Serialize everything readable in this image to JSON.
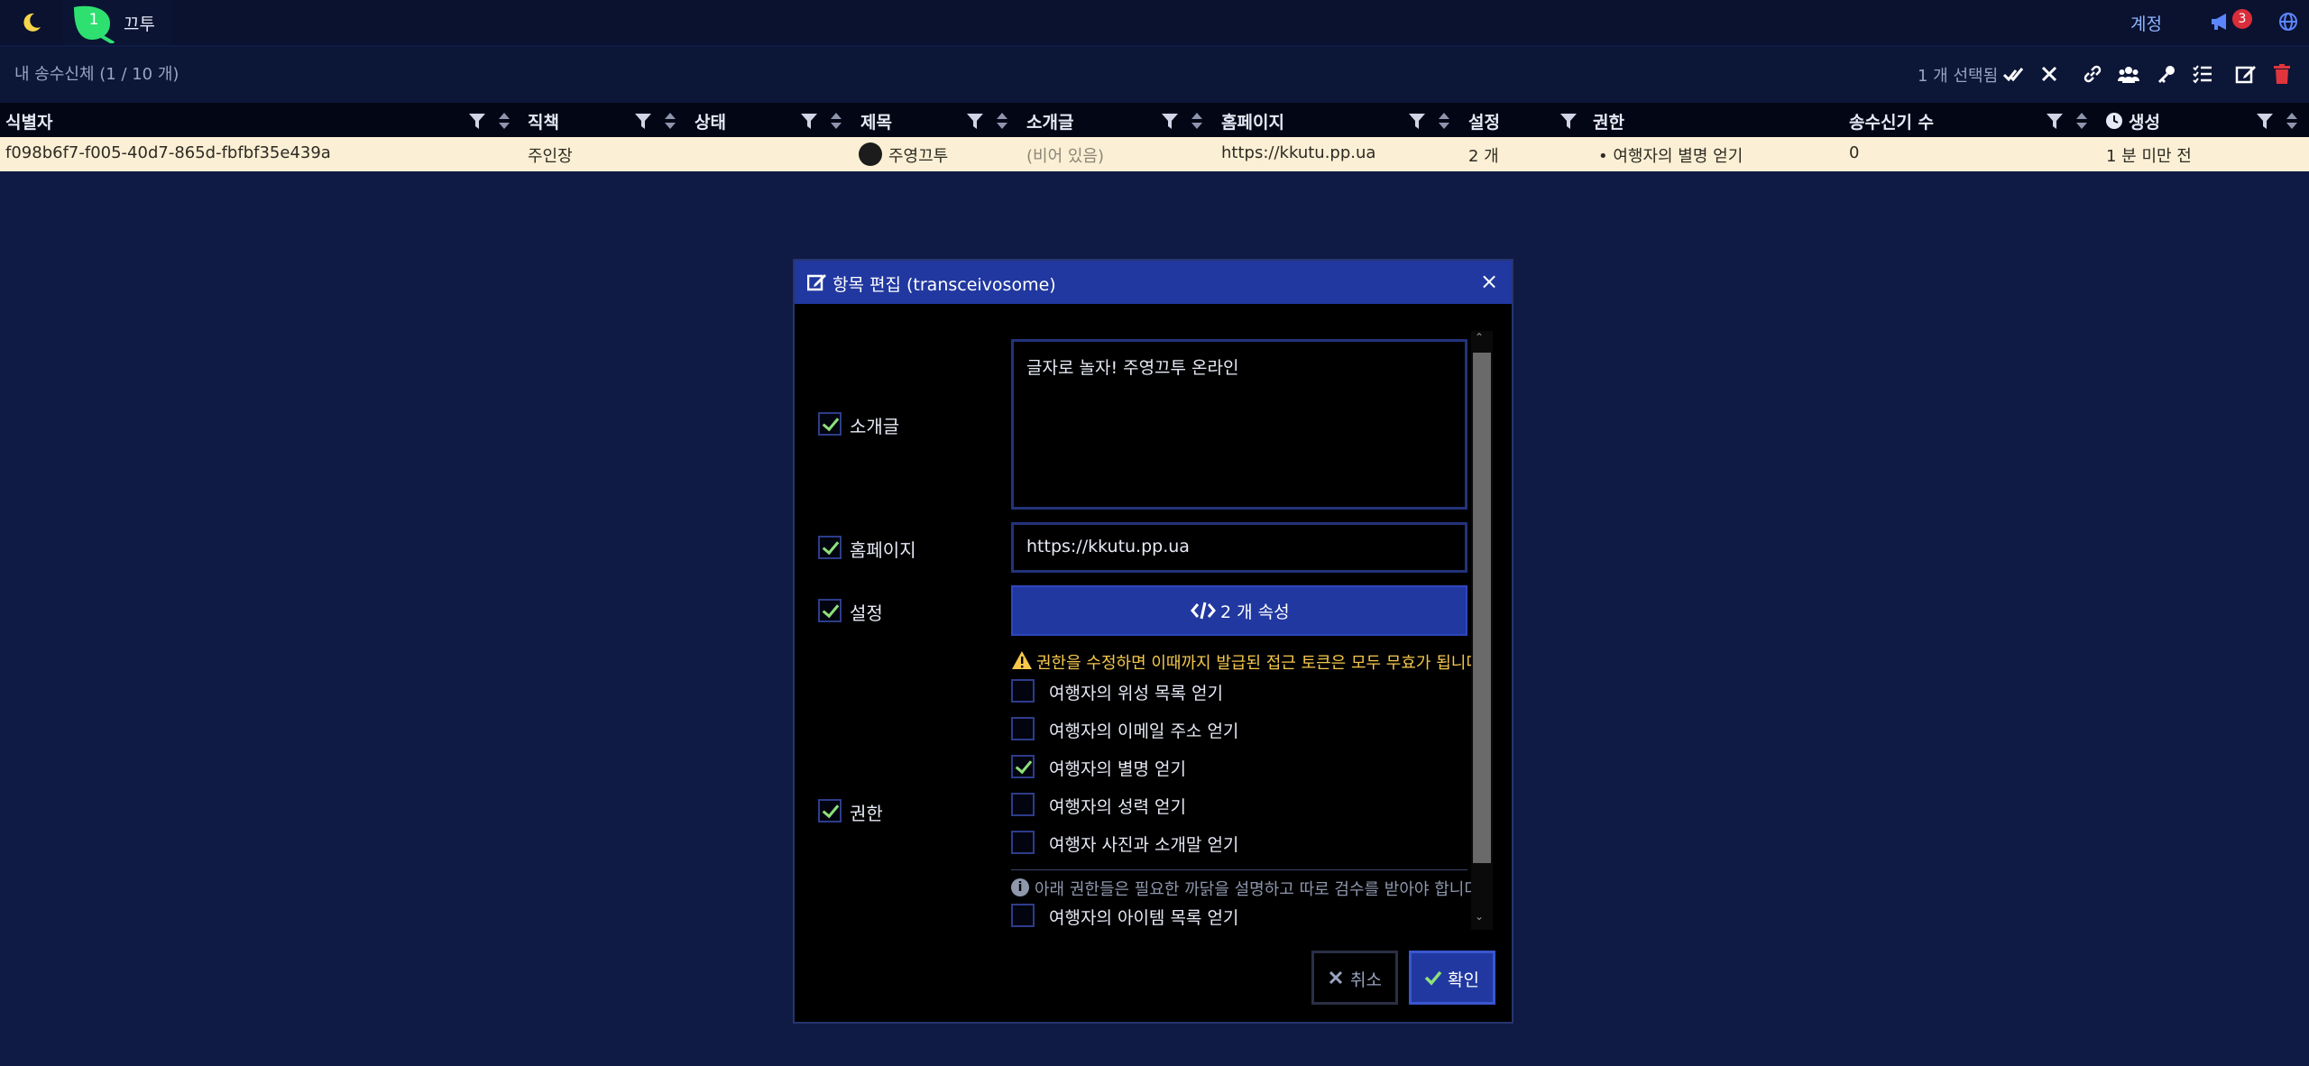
{
  "topbar": {
    "tab_count": "1",
    "app_name": "끄투",
    "account_label": "계정",
    "notification_count": "3"
  },
  "toolbar": {
    "title": "내 송수신체 (1 / 10 개)",
    "selection": "1 개 선택됨"
  },
  "table": {
    "headers": {
      "id": "식별자",
      "role": "직책",
      "status": "상태",
      "title": "제목",
      "intro": "소개글",
      "homepage": "홈페이지",
      "settings": "설정",
      "permissions": "권한",
      "receivers": "송수신기 수",
      "created": "생성"
    },
    "row": {
      "id": "f098b6f7-f005-40d7-865d-fbfbf35e439a",
      "role": "주인장",
      "status": "",
      "title": "주영끄투",
      "intro": "(비어 있음)",
      "homepage": "https://kkutu.pp.ua",
      "settings": "2 개",
      "permissions": "• 여행자의 별명 얻기",
      "receivers": "0",
      "created": "1 분 미만 전"
    }
  },
  "modal": {
    "title": "항목 편집 (transceivosome)",
    "close": "×",
    "fields": {
      "intro_label": "소개글",
      "intro_value": "글자로 놀자! 주영끄투 온라인",
      "homepage_label": "홈페이지",
      "homepage_value": "https://kkutu.pp.ua",
      "settings_label": "설정",
      "settings_button": "2 개 속성",
      "permissions_label": "권한"
    },
    "warning": "권한을 수정하면 이때까지 발급된 접근 토큰은 모두 무효가 됩니다.",
    "permissions": [
      {
        "label": "여행자의 위성 목록 얻기",
        "checked": false
      },
      {
        "label": "여행자의 이메일 주소 얻기",
        "checked": false
      },
      {
        "label": "여행자의 별명 얻기",
        "checked": true
      },
      {
        "label": "여행자의 성력 얻기",
        "checked": false
      },
      {
        "label": "여행자 사진과 소개말 얻기",
        "checked": false
      }
    ],
    "info": "아래 권한들은 필요한 까닭을 설명하고 따로 검수를 받아야 합니다.",
    "extra_permission": "여행자의 아이템 목록 얻기",
    "cancel": "취소",
    "confirm": "확인"
  },
  "colors": {
    "background": "#0f1b45",
    "accent": "#2138a0",
    "row_highlight": "#fbf0d5",
    "warning": "#f5c84c",
    "check": "#8ee07a",
    "danger": "#d92e3a"
  }
}
